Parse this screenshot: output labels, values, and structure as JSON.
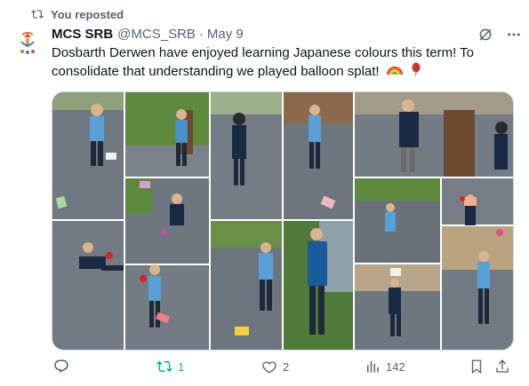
{
  "repost": {
    "label": "You reposted",
    "icon": "repost-icon"
  },
  "author": {
    "name": "MCS SRB",
    "handle": "@MCS_SRB",
    "separator": "·",
    "date": "May 9",
    "avatar_icon": "school-logo-avatar"
  },
  "header_icons": {
    "grok": "grok-icon",
    "more": "more-icon"
  },
  "post": {
    "text": "Dosbarth Derwen have enjoyed learning Japanese colours this term! To consolidate that understanding we played balloon splat!",
    "emojis": [
      "rainbow-emoji",
      "balloon-emoji"
    ]
  },
  "media": {
    "type": "photo-collage",
    "description_icon": "photo-collage"
  },
  "actions": {
    "reply": {
      "icon": "reply-icon",
      "count": ""
    },
    "repost": {
      "icon": "repost-icon",
      "count": "1",
      "active": true
    },
    "like": {
      "icon": "heart-icon",
      "count": "2"
    },
    "views": {
      "icon": "views-icon",
      "count": "142"
    },
    "bookmark": {
      "icon": "bookmark-icon"
    },
    "share": {
      "icon": "share-icon"
    }
  },
  "colors": {
    "accent": "#1d9bf0",
    "repost_active": "#00ba7c",
    "muted": "#536471",
    "text": "#0f1419"
  }
}
